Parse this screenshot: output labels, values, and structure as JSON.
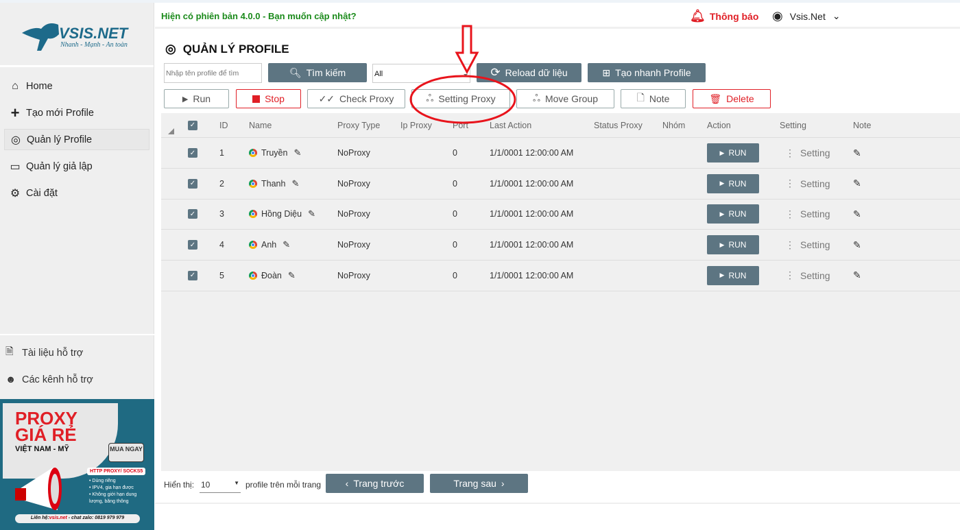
{
  "brand": {
    "name": "VSIS.NET",
    "slogan": "Nhanh - Mạnh - An toàn"
  },
  "sidebar": {
    "items": [
      {
        "label": "Home",
        "icon": "home-icon"
      },
      {
        "label": "Tạo mới Profile",
        "icon": "plus-icon"
      },
      {
        "label": "Quản lý Profile",
        "icon": "chrome-icon",
        "active": true
      },
      {
        "label": "Quản lý giả lập",
        "icon": "devices-icon"
      },
      {
        "label": "Cài đặt",
        "icon": "gear-icon"
      }
    ],
    "help": [
      {
        "label": "Tài liệu hỗ trợ",
        "icon": "document-icon"
      },
      {
        "label": "Các kênh hỗ trợ",
        "icon": "support-icon"
      }
    ]
  },
  "banner": {
    "line1": "PROXY",
    "line2": "GIÁ RẺ",
    "line3": "VIỆT NAM - MỸ",
    "buy": "MUA NGAY",
    "tag": "HTTP PROXY/ SOCKS5",
    "bullets": [
      "Dùng riêng",
      "IPV4, gia hạn được",
      "Không giới hạn dung lượng, băng thông"
    ],
    "contact_label": "Liên hệ:",
    "contact_site": "vsis.net",
    "contact_rest": " - chat zalo: 0819 979 979"
  },
  "topbar": {
    "update": "Hiện có phiên bản 4.0.0 - Bạn muốn cập nhật?",
    "notification": "Thông báo",
    "user": "Vsis.Net"
  },
  "page": {
    "title": "QUẢN LÝ PROFILE"
  },
  "toolbar": {
    "search_placeholder": "Nhập tên profile để tìm",
    "search": "Tìm kiếm",
    "group_value": "All",
    "reload": "Reload dữ liệu",
    "quick_create": "Tạo nhanh Profile",
    "run": "Run",
    "stop": "Stop",
    "check_proxy": "Check Proxy",
    "setting_proxy": "Setting Proxy",
    "move_group": "Move Group",
    "note": "Note",
    "delete": "Delete"
  },
  "table": {
    "headers": [
      "ID",
      "Name",
      "Proxy Type",
      "Ip Proxy",
      "Port",
      "Last Action",
      "Status Proxy",
      "Nhóm",
      "Action",
      "Setting",
      "Note"
    ],
    "rows": [
      {
        "id": "1",
        "name": "Truyền",
        "proxy_type": "NoProxy",
        "ip": "",
        "port": "0",
        "last_action": "1/1/0001 12:00:00 AM",
        "status": "",
        "group": "",
        "checked": true
      },
      {
        "id": "2",
        "name": "Thanh",
        "proxy_type": "NoProxy",
        "ip": "",
        "port": "0",
        "last_action": "1/1/0001 12:00:00 AM",
        "status": "",
        "group": "",
        "checked": true
      },
      {
        "id": "3",
        "name": "Hồng Diệu",
        "proxy_type": "NoProxy",
        "ip": "",
        "port": "0",
        "last_action": "1/1/0001 12:00:00 AM",
        "status": "",
        "group": "",
        "checked": true
      },
      {
        "id": "4",
        "name": "Anh",
        "proxy_type": "NoProxy",
        "ip": "",
        "port": "0",
        "last_action": "1/1/0001 12:00:00 AM",
        "status": "",
        "group": "",
        "checked": true
      },
      {
        "id": "5",
        "name": "Đoàn",
        "proxy_type": "NoProxy",
        "ip": "",
        "port": "0",
        "last_action": "1/1/0001 12:00:00 AM",
        "status": "",
        "group": "",
        "checked": true
      }
    ],
    "run_label": "RUN",
    "setting_label": "Setting"
  },
  "pagination": {
    "show_label": "Hiển thị:",
    "page_size": "10",
    "per_page_label": "profile trên mỗi trang",
    "prev": "Trang trước",
    "next": "Trang sau"
  },
  "colors": {
    "accent": "#5d7582",
    "danger": "#e01f26",
    "update": "#1a8a1a",
    "annotation": "#e8141c"
  }
}
